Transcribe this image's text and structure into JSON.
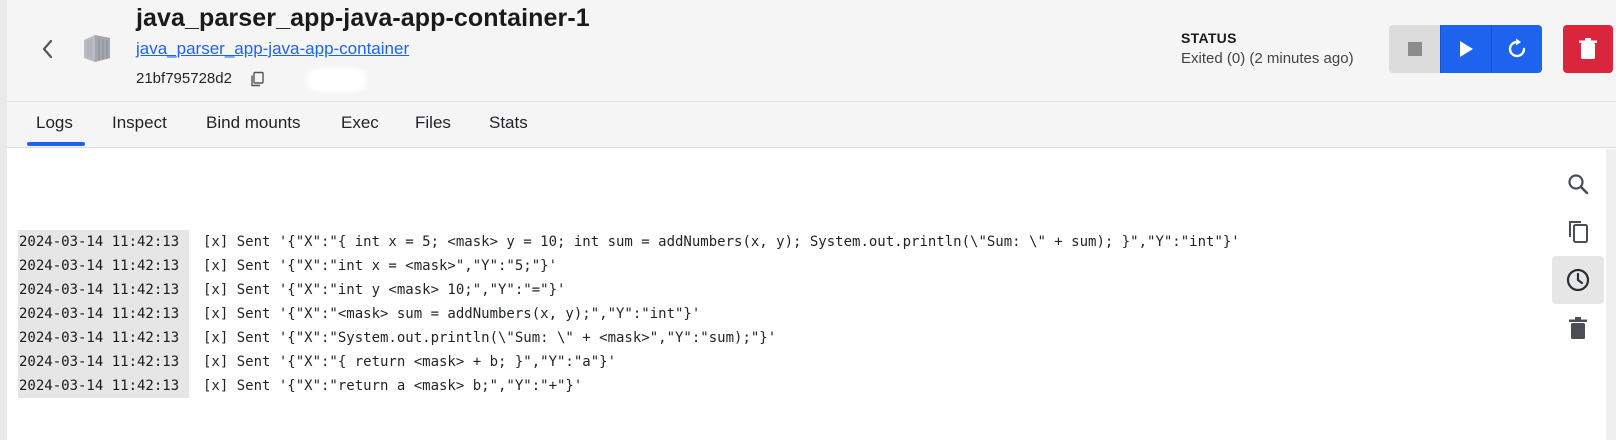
{
  "header": {
    "title": "java_parser_app-java-app-container-1",
    "image_link": "java_parser_app-java-app-container",
    "container_id": "21bf795728d2",
    "status_label": "STATUS",
    "status_value": "Exited (0) (2 minutes ago)"
  },
  "icons": {
    "back": "chevron-left-icon",
    "container": "container-icon",
    "copy_id": "copy-icon",
    "stop": "stop-icon",
    "start": "play-icon",
    "restart": "restart-icon",
    "delete": "trash-icon",
    "search": "search-icon",
    "copy_logs": "copy-icon",
    "timestamps": "clock-icon",
    "clear": "trash-icon"
  },
  "colors": {
    "accent": "#1d63ed",
    "danger": "#d9263c",
    "stop_disabled": "#dcdcdc"
  },
  "tabs": [
    {
      "label": "Logs",
      "active": true
    },
    {
      "label": "Inspect",
      "active": false
    },
    {
      "label": "Bind mounts",
      "active": false
    },
    {
      "label": "Exec",
      "active": false
    },
    {
      "label": "Files",
      "active": false
    },
    {
      "label": "Stats",
      "active": false
    }
  ],
  "logs": [
    {
      "ts": "2024-03-14 11:42:13",
      "msg": "[x] Sent '{\"X\":\"{ int x = 5; <mask> y = 10; int sum = addNumbers(x, y); System.out.println(\\\"Sum: \\\" + sum); }\",\"Y\":\"int\"}'"
    },
    {
      "ts": "2024-03-14 11:42:13",
      "msg": "[x] Sent '{\"X\":\"int x = <mask>\",\"Y\":\"5;\"}'"
    },
    {
      "ts": "2024-03-14 11:42:13",
      "msg": "[x] Sent '{\"X\":\"int y <mask> 10;\",\"Y\":\"=\"}'"
    },
    {
      "ts": "2024-03-14 11:42:13",
      "msg": "[x] Sent '{\"X\":\"<mask> sum = addNumbers(x, y);\",\"Y\":\"int\"}'"
    },
    {
      "ts": "2024-03-14 11:42:13",
      "msg": "[x] Sent '{\"X\":\"System.out.println(\\\"Sum: \\\" + <mask>\",\"Y\":\"sum);\"}'"
    },
    {
      "ts": "2024-03-14 11:42:13",
      "msg": "[x] Sent '{\"X\":\"{ return <mask> + b; }\",\"Y\":\"a\"}'"
    },
    {
      "ts": "2024-03-14 11:42:13",
      "msg": "[x] Sent '{\"X\":\"return a <mask> b;\",\"Y\":\"+\"}'"
    }
  ]
}
